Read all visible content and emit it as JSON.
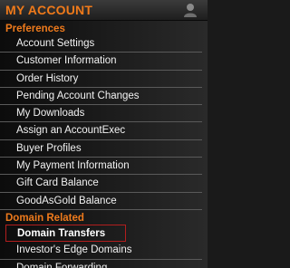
{
  "header": {
    "title": "MY ACCOUNT",
    "icon": "user-icon"
  },
  "sections": [
    {
      "label": "Preferences",
      "items": [
        {
          "label": "Account Settings"
        },
        {
          "label": "Customer Information"
        },
        {
          "label": "Order History"
        },
        {
          "label": "Pending Account Changes"
        },
        {
          "label": "My Downloads"
        },
        {
          "label": "Assign an AccountExec"
        },
        {
          "label": "Buyer Profiles"
        },
        {
          "label": "My Payment Information"
        },
        {
          "label": "Gift Card Balance"
        },
        {
          "label": "GoodAsGold Balance"
        }
      ]
    },
    {
      "label": "Domain Related",
      "items": [
        {
          "label": "Domain Transfers",
          "active": true
        },
        {
          "label": "Investor's Edge Domains"
        },
        {
          "label": "Domain Forwarding"
        }
      ]
    }
  ],
  "colors": {
    "accent": "#ee7a1c",
    "active_border": "#b21e1e",
    "text": "#f2f2f2"
  }
}
